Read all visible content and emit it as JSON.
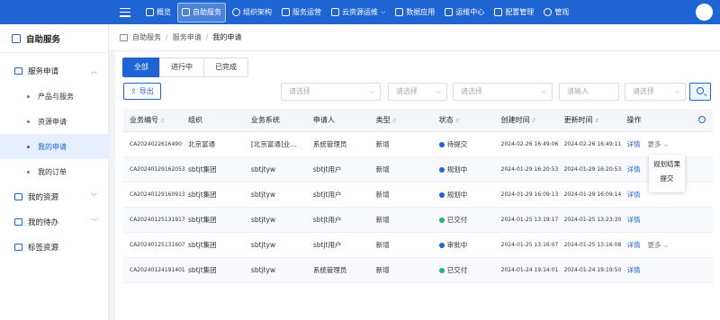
{
  "nav": {
    "items": [
      {
        "label": "概览",
        "icon": "home-icon"
      },
      {
        "label": "自助服务",
        "icon": "self-service-icon",
        "active": true
      },
      {
        "label": "组织架构",
        "icon": "org-icon"
      },
      {
        "label": "服务运营",
        "icon": "operation-icon"
      },
      {
        "label": "云资源运维",
        "icon": "cloud-icon",
        "dropdown": true
      },
      {
        "label": "数据应用",
        "icon": "chart-icon"
      },
      {
        "label": "运维中心",
        "icon": "ops-center-icon"
      },
      {
        "label": "配置管理",
        "icon": "config-icon"
      },
      {
        "label": "管观",
        "icon": "view-icon"
      }
    ]
  },
  "sidebar": {
    "title": "自助服务",
    "groups": [
      {
        "label": "服务申请",
        "expanded": true,
        "items": [
          {
            "label": "产品与服务"
          },
          {
            "label": "资源申请"
          },
          {
            "label": "我的申请",
            "active": true
          },
          {
            "label": "我的订单"
          }
        ]
      },
      {
        "label": "我的资源"
      },
      {
        "label": "我的待办"
      },
      {
        "label": "标签资源"
      }
    ]
  },
  "breadcrumb": [
    "自助服务",
    "服务申请",
    "我的申请"
  ],
  "tabs": [
    {
      "label": "全部",
      "active": true
    },
    {
      "label": "进行中"
    },
    {
      "label": "已完成"
    }
  ],
  "toolbar": {
    "export_label": "导出",
    "filters": [
      "请选择",
      "请选择",
      "请选择",
      "请输入",
      "请选择"
    ]
  },
  "table": {
    "columns": [
      "业务编号",
      "组织",
      "业务系统",
      "申请人",
      "类型",
      "状态",
      "创建时间",
      "更新时间",
      "操作"
    ],
    "rows": [
      {
        "id": "CA2024022616490",
        "org": "北京富通",
        "system": "[北京富通]业...",
        "applicant": "系统管理员",
        "type": "新增",
        "status": "待提交",
        "status_color": "#1e64d2",
        "created": "2024-02-26 16:49:06",
        "updated": "2024-02-26 16:49:11",
        "action": "详情",
        "more": "更多"
      },
      {
        "id": "CA20240129162053",
        "org": "sbtjt集团",
        "system": "sbtjtyw",
        "applicant": "sbtjt用户",
        "type": "新增",
        "status": "规划中",
        "status_color": "#1e64d2",
        "created": "2024-01-29 16:20:53",
        "updated": "2024-01-29 16:20:53",
        "action": "详情",
        "more": ""
      },
      {
        "id": "CA20240129160913",
        "org": "sbtjt集团",
        "system": "sbtjtyw",
        "applicant": "sbtjt用户",
        "type": "新增",
        "status": "规划中",
        "status_color": "#1e64d2",
        "created": "2024-01-29 16:09:13",
        "updated": "2024-01-29 16:09:14",
        "action": "详情",
        "more": ""
      },
      {
        "id": "CA20240125131917",
        "org": "sbtjt集团",
        "system": "sbtjtyw",
        "applicant": "sbtjt用户",
        "type": "新增",
        "status": "已交付",
        "status_color": "#29b36a",
        "created": "2024-01-25 13:19:17",
        "updated": "2024-01-25 13:23:30",
        "action": "详情",
        "more": ""
      },
      {
        "id": "CA20240125131607",
        "org": "sbtjt集团",
        "system": "sbtjtyw",
        "applicant": "sbtjt用户",
        "type": "新增",
        "status": "审批中",
        "status_color": "#1e64d2",
        "created": "2024-01-25 13:16:07",
        "updated": "2024-01-25 13:16:08",
        "action": "详情",
        "more": "更多"
      },
      {
        "id": "CA20240124191401",
        "org": "sbtjt集团",
        "system": "sbtjtyw",
        "applicant": "系统管理员",
        "type": "新增",
        "status": "已交付",
        "status_color": "#29b36a",
        "created": "2024-01-24 19:14:01",
        "updated": "2024-01-24 19:19:50",
        "action": "详情",
        "more": ""
      }
    ]
  },
  "more_menu": [
    "规划结果",
    "提交"
  ]
}
